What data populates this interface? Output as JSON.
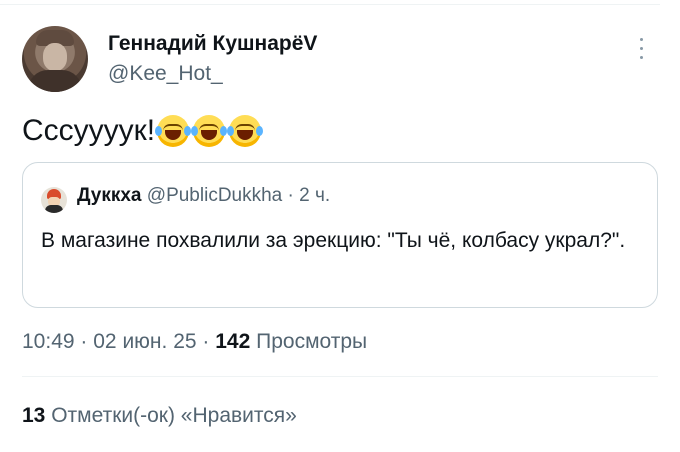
{
  "author": {
    "name": "Геннадий КушнарёV",
    "handle": "@Kee_Hot_"
  },
  "tweet": {
    "text": "Сссуууук!",
    "emojis": [
      "face-with-tears-of-joy",
      "face-with-tears-of-joy",
      "face-with-tears-of-joy"
    ]
  },
  "quote": {
    "name": "Дуккха",
    "handle": "@PublicDukkha",
    "separator": "·",
    "time": "2 ч.",
    "text": "В магазине похвалили за эрекцию: \"Ты чё, колбасу украл?\"."
  },
  "meta": {
    "time": "10:49",
    "separator": "·",
    "date": "02 июн. 25",
    "separator2": "·",
    "views_count": "142",
    "views_label": "Просмотры"
  },
  "likes": {
    "count": "13",
    "label": "Отметки(-ок) «Нравится»"
  },
  "colors": {
    "text": "#0f1419",
    "secondary": "#536471",
    "border": "#cfd9de",
    "divider": "#eff3f4"
  },
  "icons": {
    "more": "more-vertical-icon"
  }
}
